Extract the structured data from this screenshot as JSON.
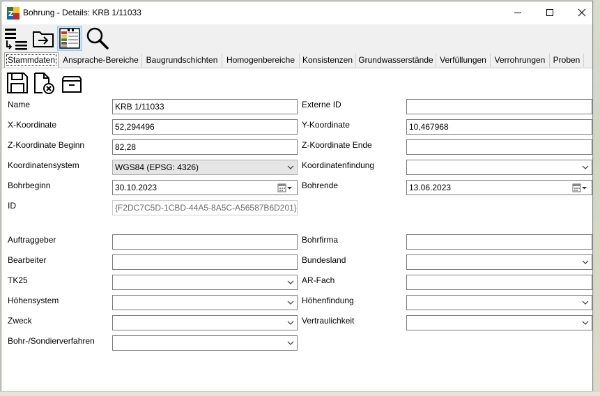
{
  "window": {
    "title": "Bohrung - Details: KRB 1/11033",
    "minimize_label": "",
    "maximize_label": "",
    "close_label": ""
  },
  "toolbar": {
    "icons": [
      "list-collapse-icon",
      "import-icon",
      "layer-table-icon",
      "search-icon"
    ]
  },
  "tabs": [
    {
      "label": "Stammdaten",
      "active": true
    },
    {
      "label": "Ansprache-Bereiche"
    },
    {
      "label": "Baugrundschichten"
    },
    {
      "label": "Homogenbereiche"
    },
    {
      "label": "Konsistenzen"
    },
    {
      "label": "Grundwasserstände"
    },
    {
      "label": "Verfüllungen"
    },
    {
      "label": "Verrohrungen"
    },
    {
      "label": "Proben"
    }
  ],
  "actions": {
    "icons": [
      "save-icon",
      "discard-icon",
      "archive-icon"
    ]
  },
  "form": {
    "left": {
      "name": {
        "label": "Name",
        "value": "KRB 1/11033"
      },
      "x": {
        "label": "X-Koordinate",
        "value": "52,294496"
      },
      "z_begin": {
        "label": "Z-Koordinate Beginn",
        "value": "82,28"
      },
      "crs": {
        "label": "Koordinatensystem",
        "value": "WGS84 (EPSG: 4326)"
      },
      "bohrbeginn": {
        "label": "Bohrbeginn",
        "value": "30.10.2023"
      },
      "id": {
        "label": "ID",
        "value": "{F2DC7C5D-1CBD-44A5-8A5C-A56587B6D201}"
      },
      "auftraggeber": {
        "label": "Auftraggeber",
        "value": ""
      },
      "bearbeiter": {
        "label": "Bearbeiter",
        "value": ""
      },
      "tk25": {
        "label": "TK25",
        "value": ""
      },
      "hoehensystem": {
        "label": "Höhensystem",
        "value": ""
      },
      "zweck": {
        "label": "Zweck",
        "value": ""
      },
      "verfahren": {
        "label": "Bohr-/Sondierverfahren",
        "value": ""
      }
    },
    "right": {
      "externe_id": {
        "label": "Externe ID",
        "value": ""
      },
      "y": {
        "label": "Y-Koordinate",
        "value": "10,467968"
      },
      "z_end": {
        "label": "Z-Koordinate Ende",
        "value": ""
      },
      "koordinatenfindung": {
        "label": "Koordinatenfindung",
        "value": ""
      },
      "bohrende": {
        "label": "Bohrende",
        "value": "13.06.2023"
      },
      "bohrfirma": {
        "label": "Bohrfirma",
        "value": ""
      },
      "bundesland": {
        "label": "Bundesland",
        "value": ""
      },
      "ar_fach": {
        "label": "AR-Fach",
        "value": ""
      },
      "hoehenfindung": {
        "label": "Höhenfindung",
        "value": ""
      },
      "vertraulichkeit": {
        "label": "Vertraulichkeit",
        "value": ""
      }
    }
  }
}
